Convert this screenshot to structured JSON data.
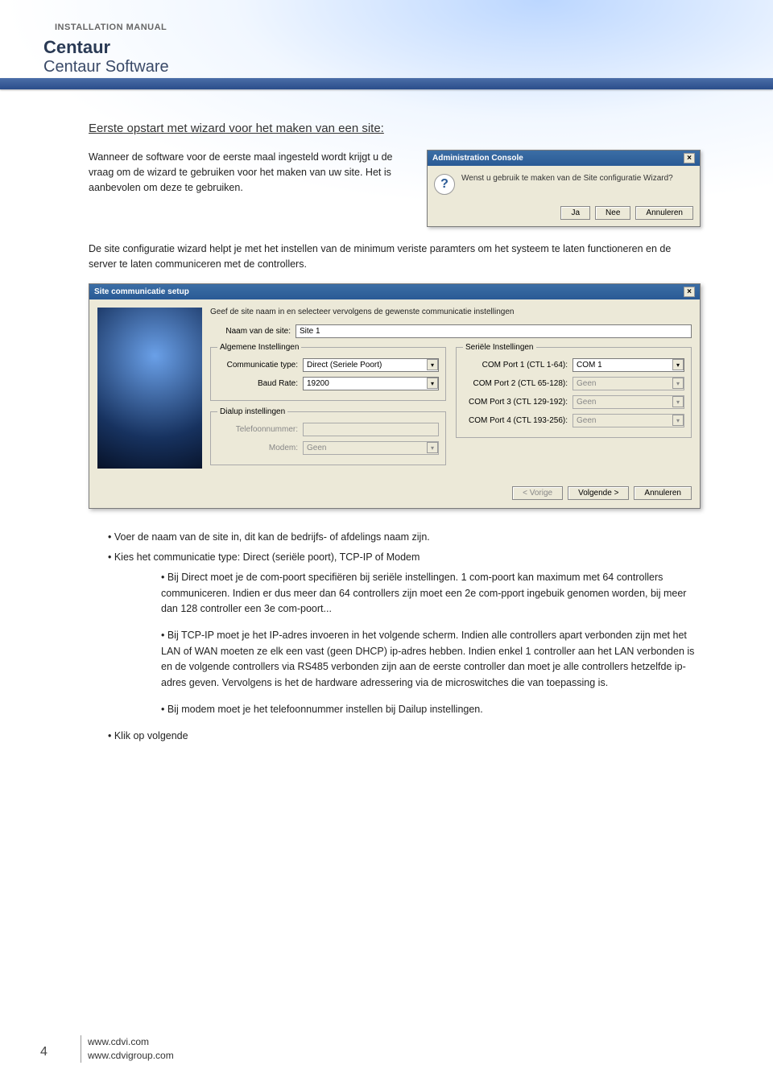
{
  "header": {
    "manual_label": "INSTALLATION MANUAL",
    "product_title": "Centaur",
    "product_subtitle": "Centaur Software"
  },
  "section_heading": "Eerste opstart met wizard voor het maken van een site:",
  "intro_para": "Wanneer de software voor de eerste maal ingesteld wordt krijgt u de vraag om de wizard te gebruiken voor het maken van uw site. Het is aanbevolen om deze te gebruiken.",
  "dialog1": {
    "title": "Administration Console",
    "message": "Wenst u gebruik te maken van de Site configuratie Wizard?",
    "btn_yes": "Ja",
    "btn_no": "Nee",
    "btn_cancel": "Annuleren"
  },
  "para2": "De site configuratie wizard helpt je met het instellen van de minimum veriste paramters om het systeem te laten functioneren en de server te laten communiceren met de controllers.",
  "dialog2": {
    "title": "Site communicatie setup",
    "instruction": "Geef de site naam in en selecteer vervolgens de gewenste communicatie instellingen",
    "site_name_label": "Naam van de site:",
    "site_name_value": "Site 1",
    "group_general": "Algemene Instellingen",
    "comm_type_label": "Communicatie type:",
    "comm_type_value": "Direct (Seriele Poort)",
    "baud_label": "Baud Rate:",
    "baud_value": "19200",
    "group_dialup": "Dialup instellingen",
    "phone_label": "Telefoonnummer:",
    "phone_value": "",
    "modem_label": "Modem:",
    "modem_value": "Geen",
    "group_serial": "Seriële Instellingen",
    "com1_label": "COM Port 1 (CTL 1-64):",
    "com1_value": "COM 1",
    "com2_label": "COM Port 2 (CTL 65-128):",
    "com2_value": "Geen",
    "com3_label": "COM Port 3 (CTL 129-192):",
    "com3_value": "Geen",
    "com4_label": "COM Port 4 (CTL 193-256):",
    "com4_value": "Geen",
    "btn_back": "< Vorige",
    "btn_next": "Volgende >",
    "btn_cancel": "Annuleren"
  },
  "bullets": {
    "b1": "• Voer de naam van de site in, dit kan de bedrijfs- of afdelings naam zijn.",
    "b2": "• Kies het communicatie type: Direct (seriële poort), TCP-IP of Modem",
    "sub1": "• Bij Direct moet je de com-poort specifiëren bij seriële instellingen. 1 com-poort kan maximum met 64 controllers communiceren. Indien er dus meer dan 64 controllers zijn moet een 2e com-pport ingebuik genomen worden, bij meer dan 128 controller een 3e com-poort...",
    "sub2": "• Bij TCP-IP moet je het IP-adres invoeren in het volgende scherm. Indien alle controllers apart verbonden zijn met het LAN of WAN moeten ze elk een vast (geen DHCP) ip-adres hebben. Indien enkel 1 controller aan het LAN verbonden is en de volgende controllers via RS485 verbonden zijn aan de eerste controller dan moet je alle controllers hetzelfde ip-adres geven. Vervolgens is het de hardware adressering via de microswitches die van toepassing is.",
    "sub3": "• Bij modem moet je het telefoonnummer instellen bij Dailup instellingen.",
    "b3": "• Klik op volgende"
  },
  "footer": {
    "page_number": "4",
    "link1": "www.cdvi.com",
    "link2": "www.cdvigroup.com"
  }
}
